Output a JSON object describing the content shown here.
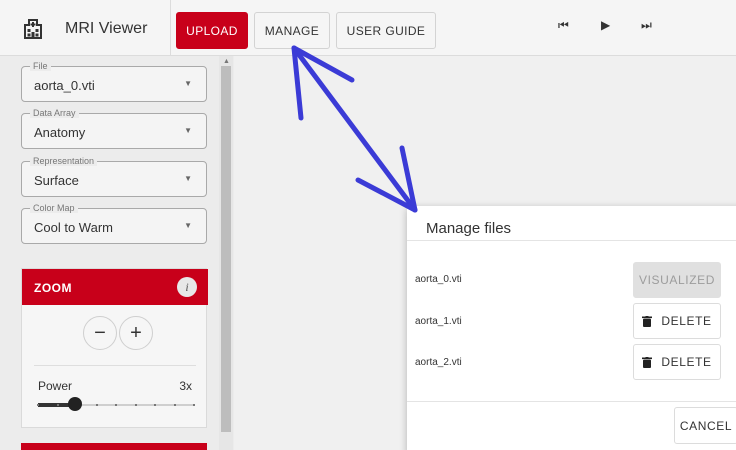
{
  "app": {
    "title": "MRI Viewer",
    "icon": "hospital-building-icon"
  },
  "nav": {
    "upload": "UPLOAD",
    "manage": "MANAGE",
    "user_guide": "USER GUIDE"
  },
  "media": {
    "first": "⏮",
    "play": "▶",
    "last": "⏭"
  },
  "sidebar": {
    "file": {
      "label": "File",
      "value": "aorta_0.vti"
    },
    "data_array": {
      "label": "Data Array",
      "value": "Anatomy"
    },
    "representation": {
      "label": "Representation",
      "value": "Surface"
    },
    "color_map": {
      "label": "Color Map",
      "value": "Cool to Warm"
    }
  },
  "zoom": {
    "title": "ZOOM",
    "info": "i",
    "minus": "−",
    "plus": "+",
    "power_label": "Power",
    "power_value": "3x",
    "power_fraction": 0.24
  },
  "dialog": {
    "title": "Manage files",
    "files": [
      {
        "name": "aorta_0.vti",
        "action": "VISUALIZED",
        "disabled": true
      },
      {
        "name": "aorta_1.vti",
        "action": "DELETE",
        "disabled": false
      },
      {
        "name": "aorta_2.vti",
        "action": "DELETE",
        "disabled": false
      }
    ],
    "cancel": "CANCEL"
  },
  "colors": {
    "accent": "#c8001a",
    "annotation_arrow": "#3b3bd6"
  }
}
